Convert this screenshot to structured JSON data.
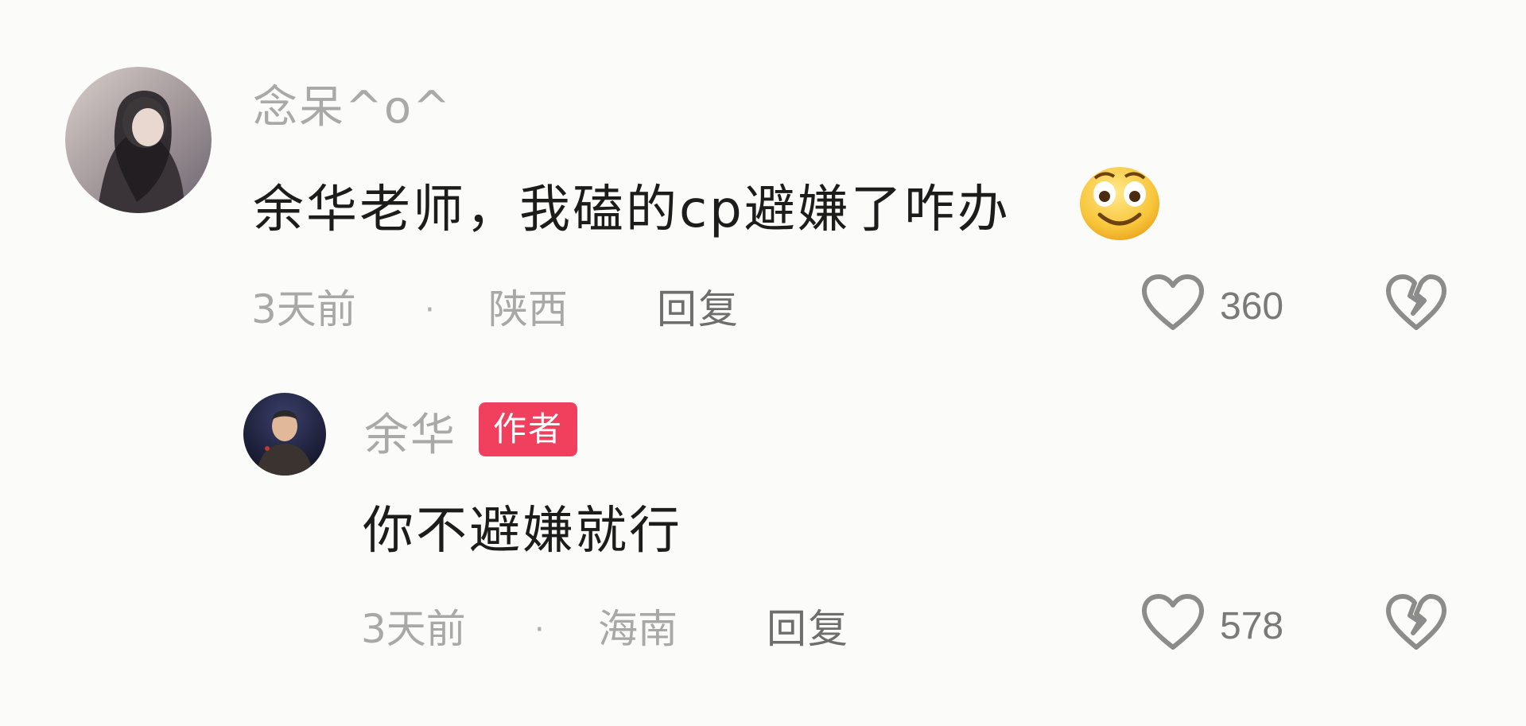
{
  "comments": [
    {
      "username": "念呆^o^",
      "text": "余华老师，我磕的cp避嫌了咋办",
      "emoji": "smiling-face-emoji",
      "time": "3天前",
      "separator": "·",
      "location": "陕西",
      "reply_label": "回复",
      "like_count": "360"
    }
  ],
  "replies": [
    {
      "username": "余华",
      "badge": "作者",
      "text": "你不避嫌就行",
      "time": "3天前",
      "separator": "·",
      "location": "海南",
      "reply_label": "回复",
      "like_count": "578"
    }
  ],
  "colors": {
    "background": "#fbfbf9",
    "badge": "#f0405e",
    "username": "#a9a9a9",
    "comment_text": "#1c1c1c"
  },
  "icons": [
    "heart-outline-icon",
    "broken-heart-icon"
  ]
}
